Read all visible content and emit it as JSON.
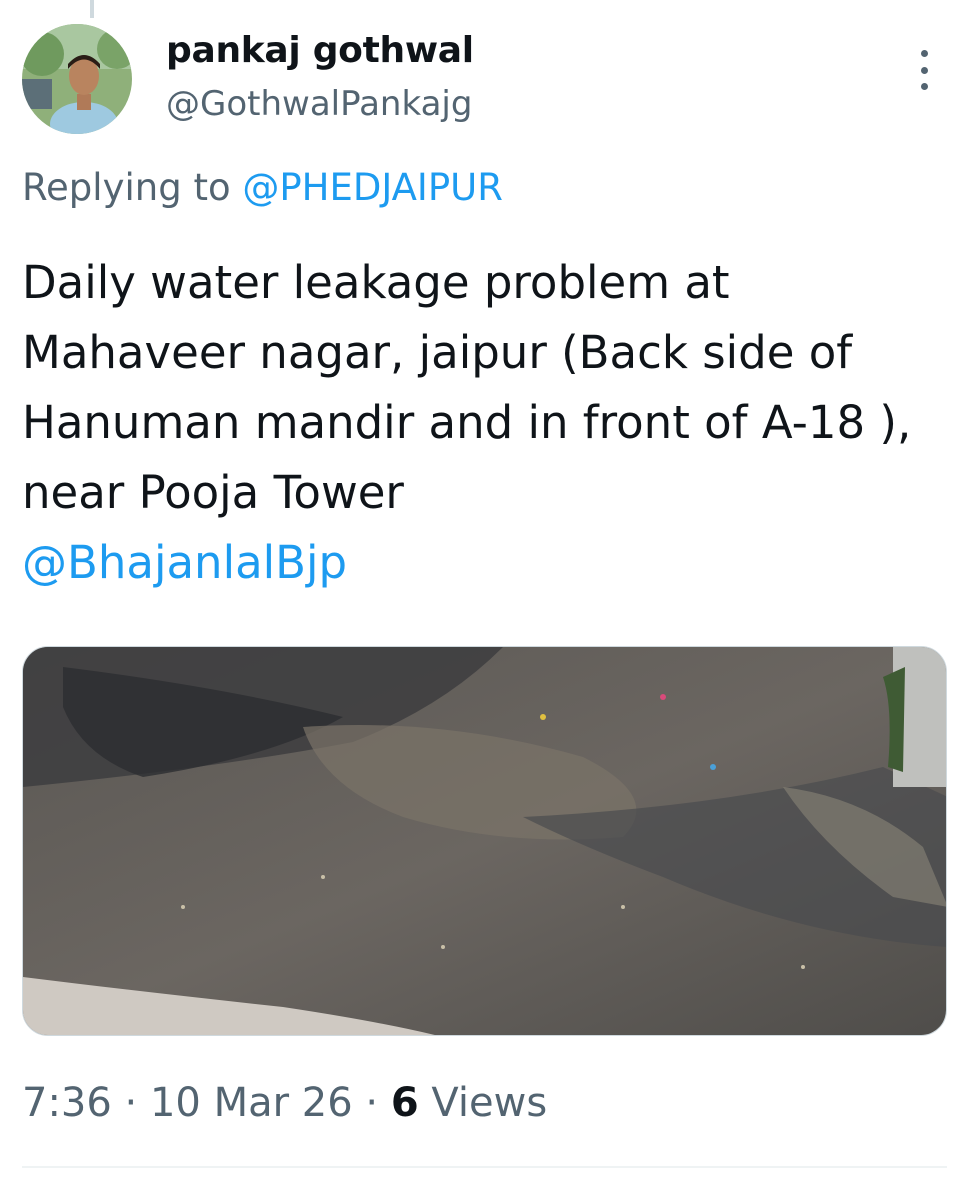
{
  "author": {
    "display_name": "pankaj gothwal",
    "handle": "@GothwalPankajg"
  },
  "reply_context": {
    "prefix": "Replying to ",
    "mention": "@PHEDJAIPUR"
  },
  "tweet": {
    "text": "Daily water leakage problem at Mahaveer nagar, jaipur (Back side of Hanuman mandir and in front of A-18 ), near Pooja Tower",
    "mention": "@BhajanlalBjp"
  },
  "meta": {
    "time": "7:36",
    "sep1": " · ",
    "date": "10 Mar 26",
    "sep2": " · ",
    "views_count": "6",
    "views_label": " Views"
  },
  "icons": {
    "more": "more-vertical-icon"
  },
  "colors": {
    "link": "#1d9bf0",
    "secondary_text": "#536471",
    "primary_text": "#0f1419"
  }
}
